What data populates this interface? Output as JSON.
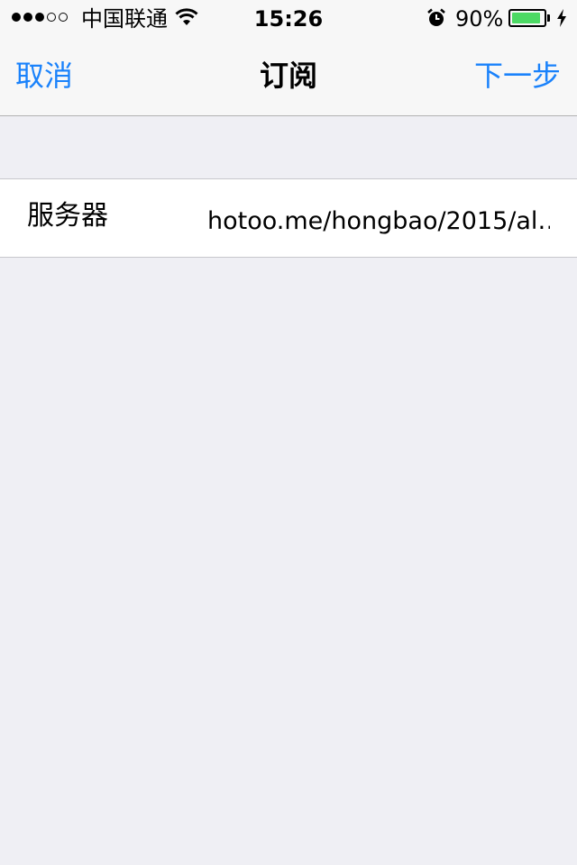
{
  "status_bar": {
    "signal_bars": 5,
    "signal_filled": 3,
    "carrier": "中国联通",
    "time": "15:26",
    "battery_percent": "90%",
    "battery_level": 0.9,
    "icons": [
      "wifi-icon",
      "alarm-icon",
      "battery-icon",
      "charging-icon"
    ]
  },
  "nav_bar": {
    "left_button": "取消",
    "title": "订阅",
    "right_button": "下一步"
  },
  "form": {
    "rows": [
      {
        "label": "服务器",
        "value": "hotoo.me/hongbao/2015/al…"
      }
    ]
  },
  "colors": {
    "accent": "#1a82fb",
    "background": "#efeff4",
    "bar_background": "#f7f7f7",
    "battery_fill": "#4cd964",
    "separator": "#c8c7cc"
  }
}
